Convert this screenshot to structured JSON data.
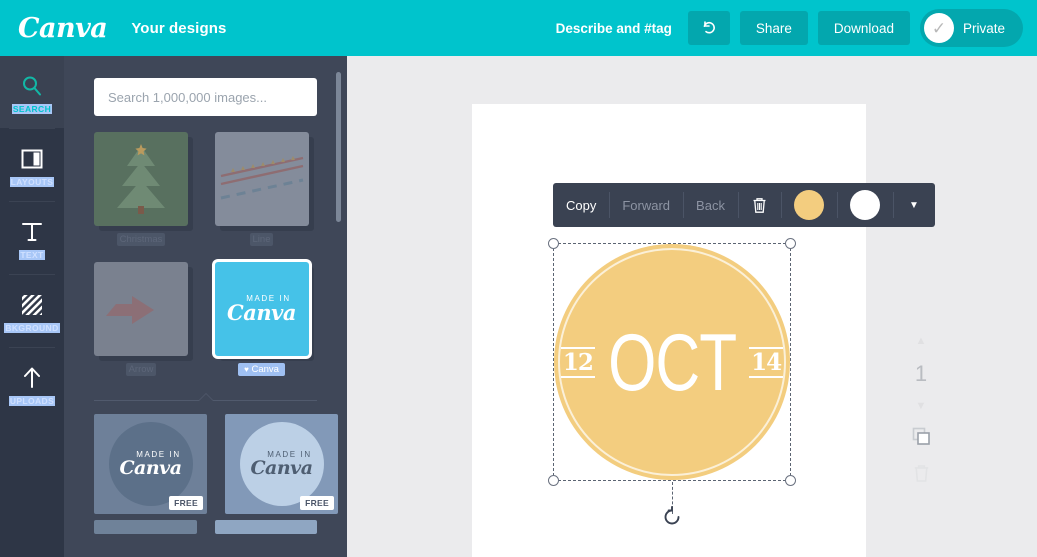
{
  "header": {
    "logo_text": "Canva",
    "subtitle": "Your designs",
    "describe_tag": "Describe and #tag",
    "undo_icon": "undo-arrow-icon",
    "share_label": "Share",
    "download_label": "Download",
    "privacy_label": "Private",
    "privacy_check_icon": "check-circle-icon",
    "accent_color": "#00c4cc",
    "button_color": "#03a7ae"
  },
  "rail": {
    "items": [
      {
        "label": "SEARCH",
        "icon": "magnifier-icon",
        "active": true
      },
      {
        "label": "LAYOUTS",
        "icon": "layouts-grid-icon",
        "active": false
      },
      {
        "label": "TEXT",
        "icon": "text-t-icon",
        "active": false
      },
      {
        "label": "BKGROUND",
        "icon": "hatched-square-icon",
        "active": false
      },
      {
        "label": "UPLOADS",
        "icon": "upload-arrow-icon",
        "active": false
      }
    ]
  },
  "panel": {
    "search": {
      "placeholder": "Search 1,000,000 images...",
      "value": ""
    },
    "thumbnails": [
      {
        "caption": "Christmas",
        "selected": false,
        "kind": "tree",
        "bg": "#58705f"
      },
      {
        "caption": "Line",
        "selected": false,
        "kind": "lines",
        "bg": "#848c9b"
      },
      {
        "caption": "Arrow",
        "selected": false,
        "kind": "arrow",
        "bg": "#7a818f"
      },
      {
        "caption": "Canva",
        "selected": true,
        "kind": "canva",
        "bg": "#45c2e8",
        "heart_icon": "heart-icon"
      }
    ],
    "results": [
      {
        "badge": "FREE",
        "bg": "#6e8099",
        "circle": "#5c7089",
        "text_color": "#ffffff",
        "top_label": "MADE IN",
        "main_label": "Canva"
      },
      {
        "badge": "FREE",
        "bg": "#8299b8",
        "circle": "#bcd0e6",
        "text_color": "#4e5e72",
        "top_label": "MADE IN",
        "main_label": "Canva"
      }
    ]
  },
  "editor": {
    "object_toolbar": {
      "copy_label": "Copy",
      "forward_label": "Forward",
      "back_label": "Back",
      "trash_icon": "trash-icon",
      "swatch_primary": "#f3cd7f",
      "swatch_secondary": "#ffffff",
      "caret_icon": "chevron-down-icon"
    },
    "selected_object": {
      "type": "date-badge",
      "left_number": "12",
      "month": "OCT",
      "right_number": "14",
      "fill_color": "#f3cd7f",
      "text_color": "#ffffff"
    },
    "rotate_icon": "rotate-handle-icon",
    "page_rail": {
      "up_icon": "chevron-up-icon",
      "page_number": "1",
      "down_icon": "chevron-down-icon",
      "duplicate_icon": "duplicate-page-icon",
      "delete_icon": "trash-page-icon"
    }
  }
}
